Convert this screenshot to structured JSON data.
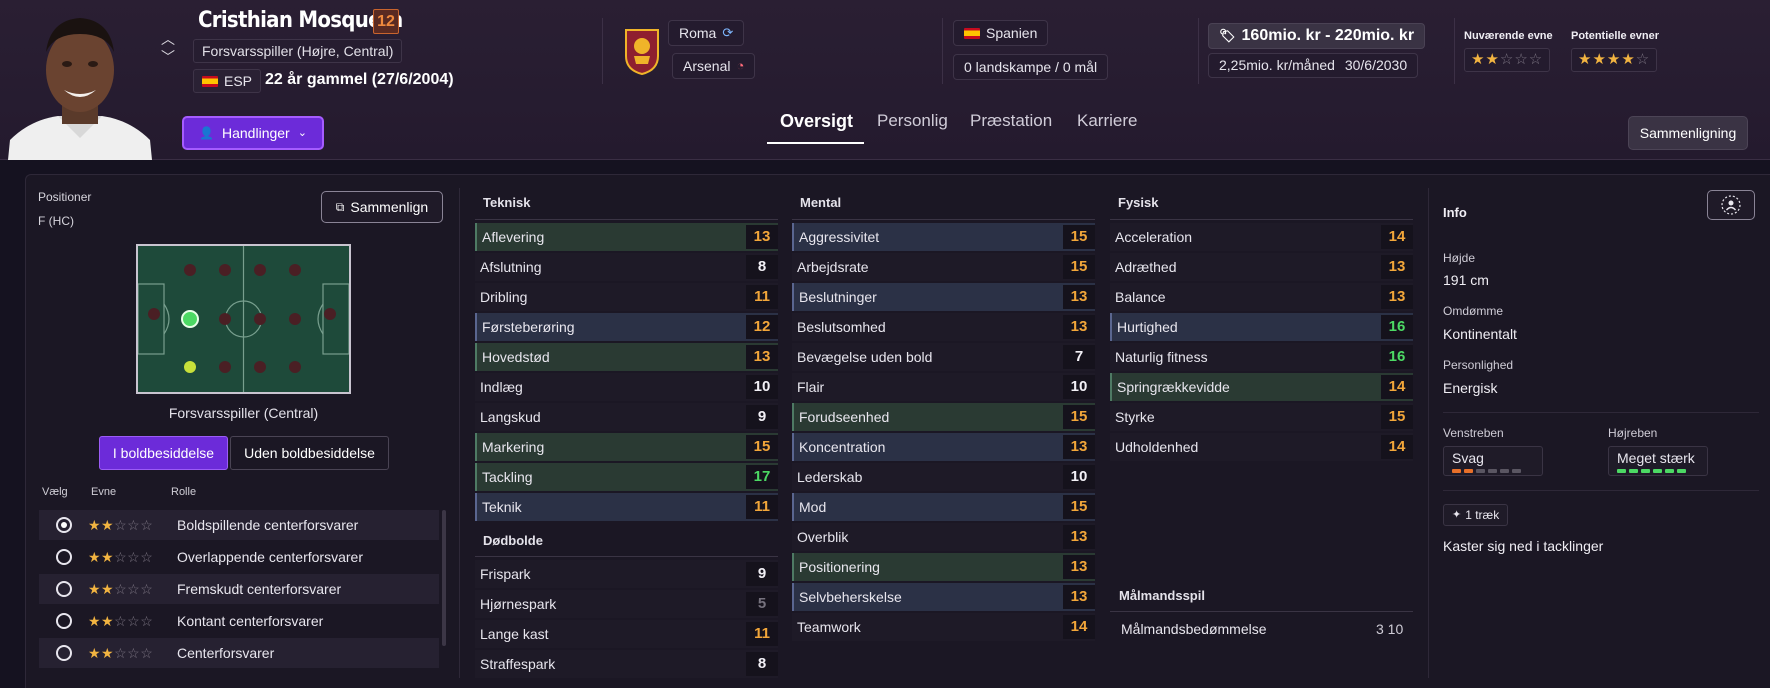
{
  "player": {
    "name": "Cristhian Mosquera",
    "ca": "12",
    "position": "Forsvarsspiller (Højre, Central)",
    "nationality": "ESP",
    "age": "22 år gammel (27/6/2004)"
  },
  "clubs": {
    "current": "Roma",
    "parent": "Arsenal"
  },
  "country": {
    "name": "Spanien",
    "caps": "0 landskampe / 0 mål"
  },
  "value": {
    "range": "160mio. kr - 220mio. kr",
    "wage": "2,25mio. kr/måned",
    "contract_end": "30/6/2030"
  },
  "ability": {
    "current_label": "Nuværende evne",
    "current_stars": 2,
    "potential_label": "Potentielle evner",
    "potential_stars": 4
  },
  "actions_label": "Handlinger",
  "tabs": [
    {
      "label": "Oversigt"
    },
    {
      "label": "Personlig"
    },
    {
      "label": "Præstation"
    },
    {
      "label": "Karriere"
    }
  ],
  "compare_label": "Sammenligning",
  "positions": {
    "label": "Positioner",
    "value": "F (HC)",
    "compare_label": "Sammenlign",
    "caption": "Forsvarsspiller (Central)",
    "toggle_in": "I boldbesiddelse",
    "toggle_out": "Uden boldbesiddelse"
  },
  "roles": {
    "headers": {
      "select": "Vælg",
      "ability": "Evne",
      "role": "Rolle"
    },
    "items": [
      {
        "name": "Boldspillende centerforsvarer",
        "stars": 2,
        "selected": true
      },
      {
        "name": "Overlappende centerforsvarer",
        "stars": 2,
        "selected": false
      },
      {
        "name": "Fremskudt centerforsvarer",
        "stars": 2,
        "selected": false
      },
      {
        "name": "Kontant centerforsvarer",
        "stars": 2,
        "selected": false
      },
      {
        "name": "Centerforsvarer",
        "stars": 2,
        "selected": false
      }
    ]
  },
  "technical": {
    "title": "Teknisk",
    "items": [
      {
        "name": "Aflevering",
        "value": "13",
        "hl": "g"
      },
      {
        "name": "Afslutning",
        "value": "8",
        "hl": ""
      },
      {
        "name": "Dribling",
        "value": "11",
        "hl": ""
      },
      {
        "name": "Førsteberøring",
        "value": "12",
        "hl": "b"
      },
      {
        "name": "Hovedstød",
        "value": "13",
        "hl": "g"
      },
      {
        "name": "Indlæg",
        "value": "10",
        "hl": ""
      },
      {
        "name": "Langskud",
        "value": "9",
        "hl": ""
      },
      {
        "name": "Markering",
        "value": "15",
        "hl": "g"
      },
      {
        "name": "Tackling",
        "value": "17",
        "hl": "g"
      },
      {
        "name": "Teknik",
        "value": "11",
        "hl": "b"
      }
    ]
  },
  "setpieces": {
    "title": "Dødbolde",
    "items": [
      {
        "name": "Frispark",
        "value": "9",
        "hl": ""
      },
      {
        "name": "Hjørnespark",
        "value": "5",
        "hl": ""
      },
      {
        "name": "Lange kast",
        "value": "11",
        "hl": ""
      },
      {
        "name": "Straffespark",
        "value": "8",
        "hl": ""
      }
    ]
  },
  "mental": {
    "title": "Mental",
    "items": [
      {
        "name": "Aggressivitet",
        "value": "15",
        "hl": "b"
      },
      {
        "name": "Arbejdsrate",
        "value": "15",
        "hl": ""
      },
      {
        "name": "Beslutninger",
        "value": "13",
        "hl": "b"
      },
      {
        "name": "Beslutsomhed",
        "value": "13",
        "hl": ""
      },
      {
        "name": "Bevægelse uden bold",
        "value": "7",
        "hl": ""
      },
      {
        "name": "Flair",
        "value": "10",
        "hl": ""
      },
      {
        "name": "Forudseenhed",
        "value": "15",
        "hl": "g"
      },
      {
        "name": "Koncentration",
        "value": "13",
        "hl": "b"
      },
      {
        "name": "Lederskab",
        "value": "10",
        "hl": ""
      },
      {
        "name": "Mod",
        "value": "15",
        "hl": "b"
      },
      {
        "name": "Overblik",
        "value": "13",
        "hl": ""
      },
      {
        "name": "Positionering",
        "value": "13",
        "hl": "g"
      },
      {
        "name": "Selvbeherskelse",
        "value": "13",
        "hl": "b"
      },
      {
        "name": "Teamwork",
        "value": "14",
        "hl": ""
      }
    ]
  },
  "physical": {
    "title": "Fysisk",
    "items": [
      {
        "name": "Acceleration",
        "value": "14",
        "hl": ""
      },
      {
        "name": "Adræthed",
        "value": "13",
        "hl": ""
      },
      {
        "name": "Balance",
        "value": "13",
        "hl": ""
      },
      {
        "name": "Hurtighed",
        "value": "16",
        "hl": "b"
      },
      {
        "name": "Naturlig fitness",
        "value": "16",
        "hl": ""
      },
      {
        "name": "Springrækkevidde",
        "value": "14",
        "hl": "g"
      },
      {
        "name": "Styrke",
        "value": "15",
        "hl": ""
      },
      {
        "name": "Udholdenhed",
        "value": "14",
        "hl": ""
      }
    ]
  },
  "goalkeeping": {
    "title": "Målmandsspil",
    "rating_label": "Målmandsbedømmelse",
    "rating_value": "3 10"
  },
  "info": {
    "title": "Info",
    "height_label": "Højde",
    "height": "191 cm",
    "reputation_label": "Omdømme",
    "reputation": "Kontinentalt",
    "personality_label": "Personlighed",
    "personality": "Energisk",
    "left_foot_label": "Venstreben",
    "left_foot": "Svag",
    "left_foot_level": 2,
    "right_foot_label": "Højreben",
    "right_foot": "Meget stærk",
    "right_foot_level": 6,
    "traits_count": "1 træk",
    "trait": "Kaster sig ned i tacklinger"
  },
  "colors": {
    "accent": "#6c2bd9",
    "orange": "#f2a63a",
    "green": "#4cd964",
    "star": "#f2b441"
  }
}
